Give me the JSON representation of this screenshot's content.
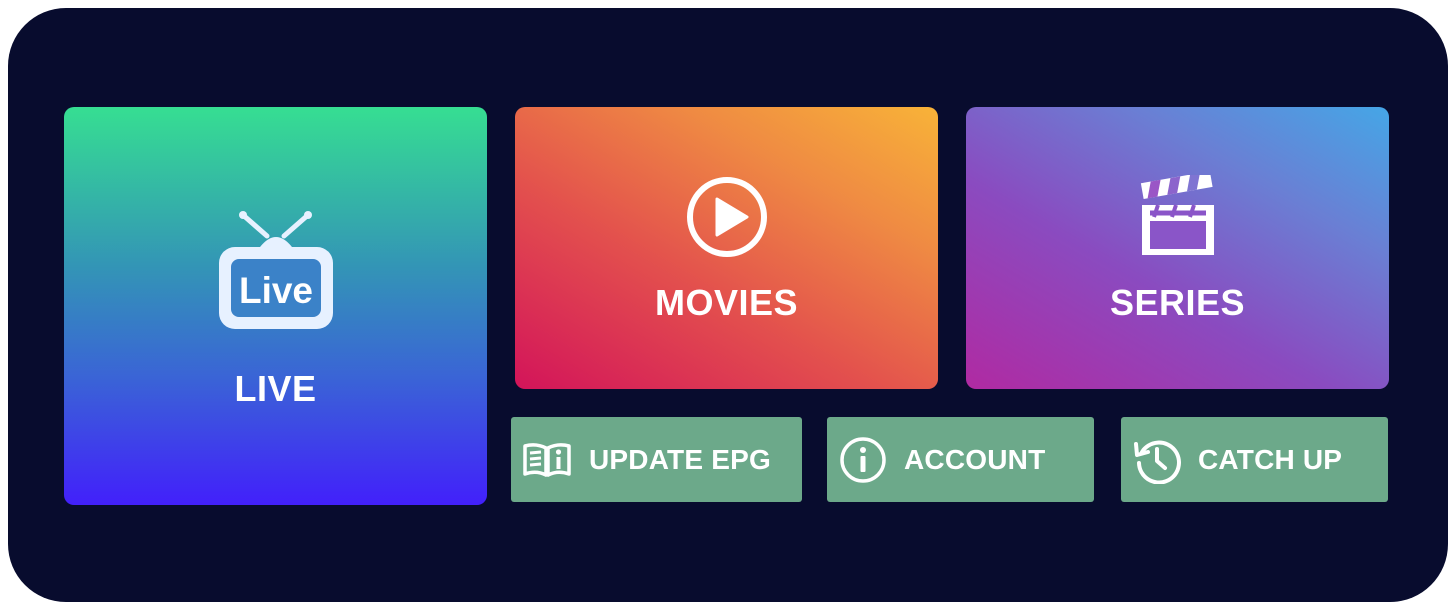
{
  "tiles": {
    "live": {
      "label": "LIVE",
      "badge_text": "Live",
      "icon": "tv-live-icon"
    },
    "movies": {
      "label": "MOVIES",
      "icon": "play-circle-icon"
    },
    "series": {
      "label": "SERIES",
      "icon": "clapperboard-icon"
    }
  },
  "actions": {
    "update_epg": {
      "label": "UPDATE EPG",
      "icon": "book-info-icon"
    },
    "account": {
      "label": "ACCOUNT",
      "icon": "info-circle-icon"
    },
    "catch_up": {
      "label": "CATCH UP",
      "icon": "history-icon"
    }
  },
  "colors": {
    "background": "#080c2e",
    "action_button": "#6ca98a",
    "live_gradient": [
      "#36de92",
      "#4220fb"
    ],
    "movies_gradient": [
      "#d3145a",
      "#f8b338"
    ],
    "series_gradient": [
      "#b02aa2",
      "#45a6e6"
    ]
  }
}
